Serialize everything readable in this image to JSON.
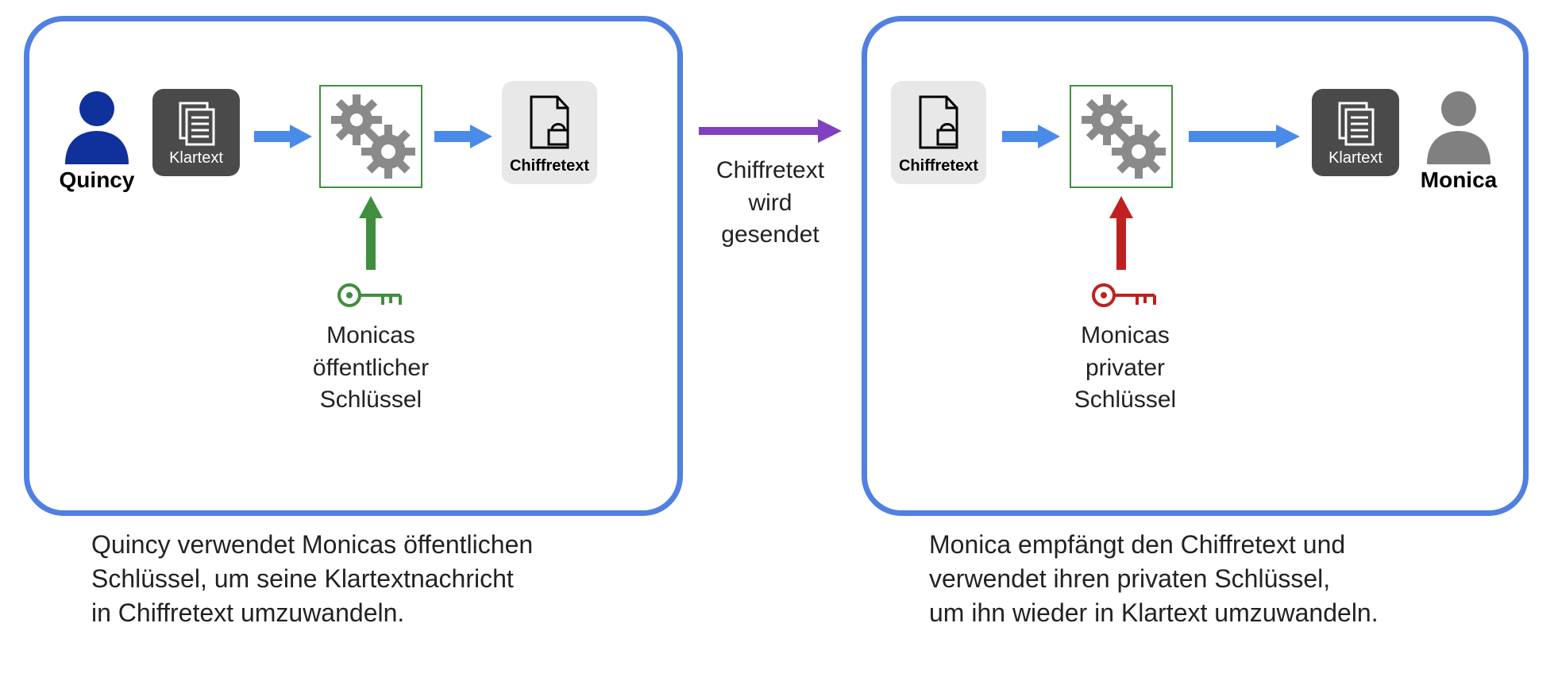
{
  "sender": {
    "name": "Quincy"
  },
  "receiver": {
    "name": "Monica"
  },
  "labels": {
    "plaintext": "Klartext",
    "ciphertext": "Chiffretext"
  },
  "keys": {
    "public": {
      "line1": "Monicas",
      "line2": "öffentlicher",
      "line3": "Schlüssel"
    },
    "private": {
      "line1": "Monicas",
      "line2": "privater",
      "line3": "Schlüssel"
    }
  },
  "transit": {
    "line1": "Chiffretext",
    "line2": "wird",
    "line3": "gesendet"
  },
  "captions": {
    "left": {
      "l1": "Quincy verwendet Monicas öffentlichen",
      "l2": "Schlüssel, um seine Klartextnachricht",
      "l3": "in Chiffretext umzuwandeln."
    },
    "right": {
      "l1": "Monica empfängt den Chiffretext und",
      "l2": "verwendet ihren privaten Schlüssel,",
      "l3": "um ihn wieder in Klartext umzuwandeln."
    }
  },
  "colors": {
    "panel_border": "#5080e0",
    "arrow_blue": "#4a8ae8",
    "arrow_green": "#3f8f3f",
    "arrow_red": "#c02020",
    "arrow_purple": "#8040c0",
    "user_sender": "#10309b",
    "user_receiver": "#808080",
    "docbox_bg": "#4a4a4a",
    "gear_fill": "#8a8a8a",
    "cipher_bg": "#e8e8e8"
  }
}
